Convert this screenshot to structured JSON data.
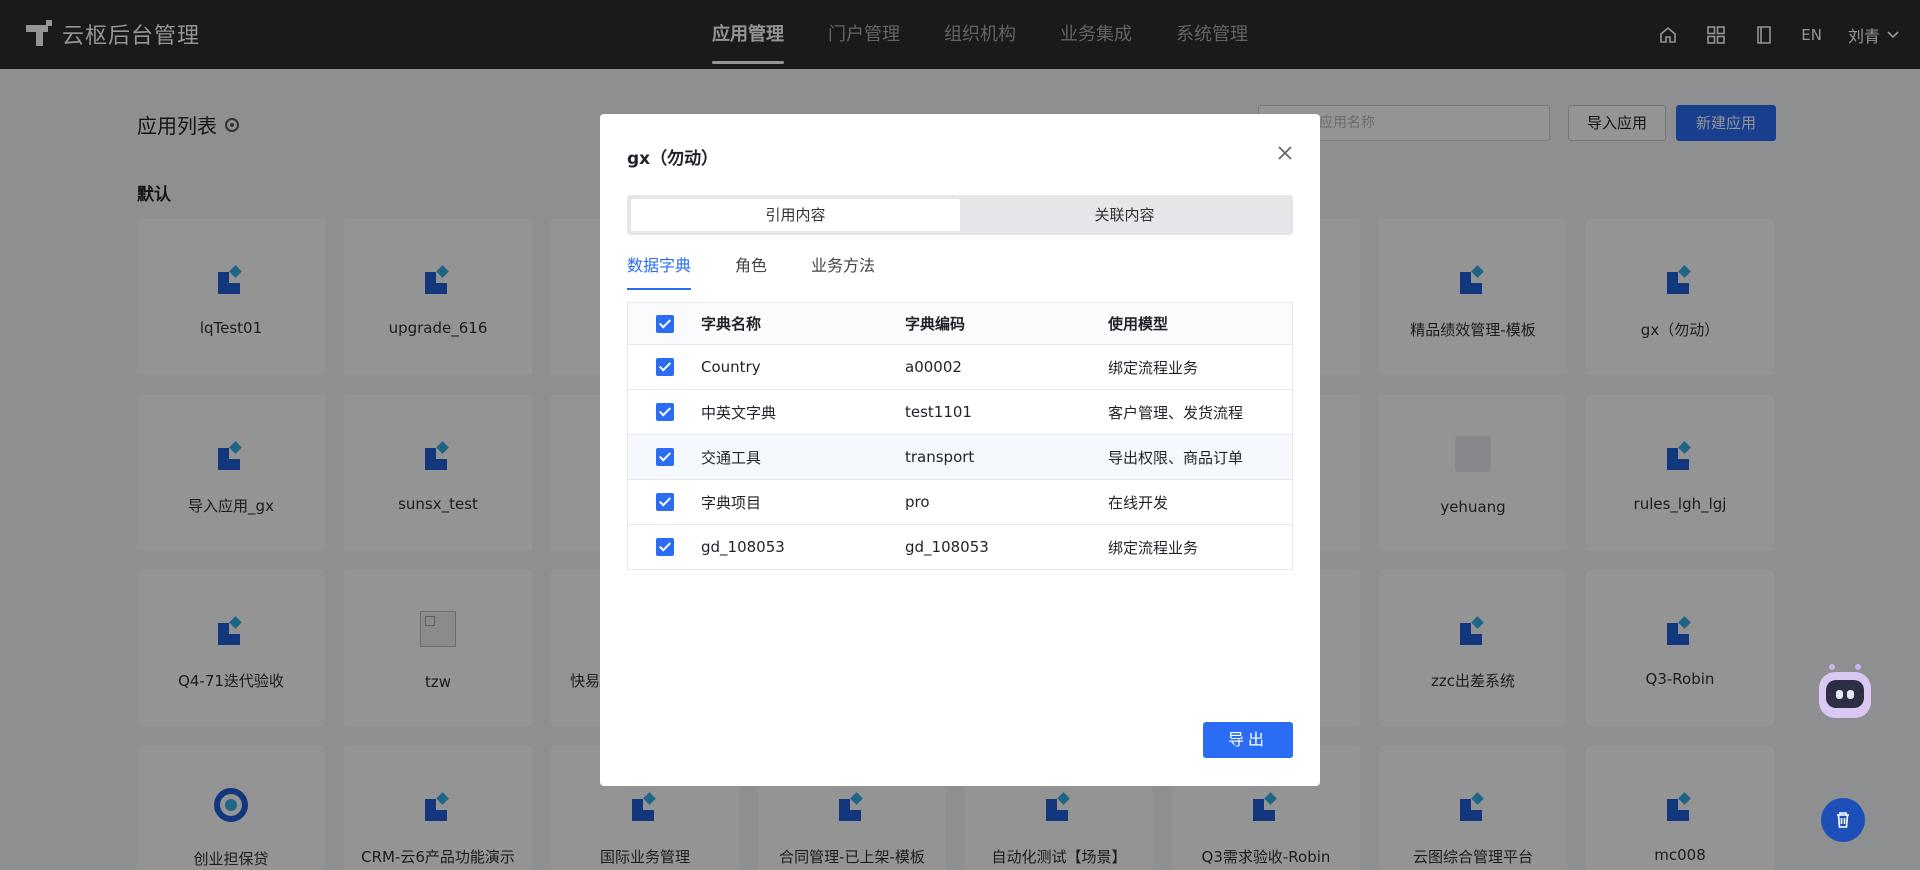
{
  "brand": {
    "title": "云枢后台管理"
  },
  "nav": {
    "items": [
      "应用管理",
      "门户管理",
      "组织机构",
      "业务集成",
      "系统管理"
    ]
  },
  "header_tools": {
    "lang": "EN",
    "user": "刘青"
  },
  "page": {
    "title": "应用列表",
    "section": "默认",
    "search_placeholder": "应用名称",
    "import_label": "导入应用",
    "new_label": "新建应用"
  },
  "cards": [
    {
      "name": "lqTest01",
      "icon": "grid"
    },
    {
      "name": "upgrade_616",
      "icon": "grid"
    },
    {
      "name": "精品绩效管理-模板",
      "icon": "grid"
    },
    {
      "name": "gx（勿动）",
      "icon": "grid"
    },
    {
      "name": "导入应用_gx",
      "icon": "grid"
    },
    {
      "name": "sunsx_test",
      "icon": "grid"
    },
    {
      "name": "yehuang",
      "icon": "spin"
    },
    {
      "name": "rules_lgh_lgj",
      "icon": "grid"
    },
    {
      "name": "Q4-71迭代验收",
      "icon": "grid"
    },
    {
      "name": "tzw",
      "icon": "broken"
    },
    {
      "name": "快易",
      "icon": "none"
    },
    {
      "name": "zzc出差系统",
      "icon": "grid"
    },
    {
      "name": "Q3-Robin",
      "icon": "grid"
    },
    {
      "name": "创业担保贷",
      "icon": "ring"
    },
    {
      "name": "CRM-云6产品功能演示",
      "icon": "grid"
    },
    {
      "name": "国际业务管理",
      "icon": "grid"
    },
    {
      "name": "合同管理-已上架-模板",
      "icon": "grid"
    },
    {
      "name": "自动化测试【场景】",
      "icon": "grid"
    },
    {
      "name": "Q3需求验收-Robin",
      "icon": "grid"
    },
    {
      "name": "云图综合管理平台",
      "icon": "grid"
    },
    {
      "name": "mc008",
      "icon": "grid"
    }
  ],
  "modal": {
    "title": "gx（勿动）",
    "segments": [
      "引用内容",
      "关联内容"
    ],
    "tabs": [
      "数据字典",
      "角色",
      "业务方法"
    ],
    "columns": [
      "字典名称",
      "字典编码",
      "使用模型"
    ],
    "rows": [
      {
        "name": "Country",
        "code": "a00002",
        "model": "绑定流程业务"
      },
      {
        "name": "中英文字典",
        "code": "test1101",
        "model": "客户管理、发货流程"
      },
      {
        "name": "交通工具",
        "code": "transport",
        "model": "导出权限、商品订单"
      },
      {
        "name": "字典项目",
        "code": "pro",
        "model": "在线开发"
      },
      {
        "name": "gd_108053",
        "code": "gd_108053",
        "model": "绑定流程业务"
      }
    ],
    "export_label": "导出"
  },
  "colors": {
    "primary": "#2a6df4",
    "topbar": "#2b2d31",
    "overlay": "rgba(0,0,0,0.42)"
  }
}
